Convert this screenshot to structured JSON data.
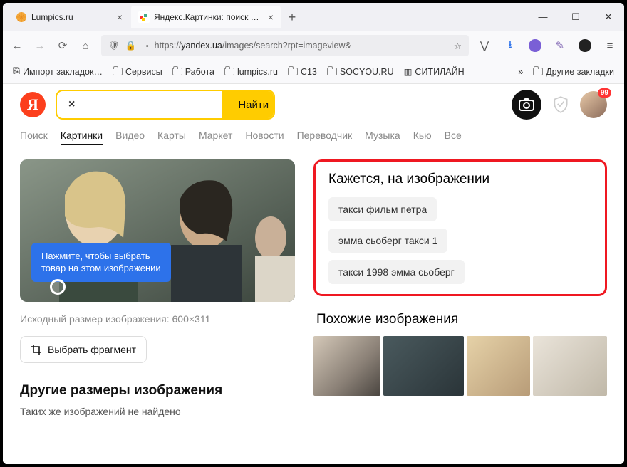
{
  "browser": {
    "tabs": [
      {
        "label": "Lumpics.ru"
      },
      {
        "label": "Яндекс.Картинки: поиск по из"
      }
    ],
    "url_prefix": "https://",
    "url_host": "yandex.ua",
    "url_path": "/images/search?rpt=imageview&"
  },
  "bookmarks": [
    "Импорт закладок…",
    "Сервисы",
    "Работа",
    "lumpics.ru",
    "C13",
    "SOCYOU.RU",
    "СИТИЛАЙН"
  ],
  "bookmarks_more": "Другие закладки",
  "search": {
    "button": "Найти",
    "badge": "99"
  },
  "nav": [
    "Поиск",
    "Картинки",
    "Видео",
    "Карты",
    "Маркет",
    "Новости",
    "Переводчик",
    "Музыка",
    "Кью",
    "Все"
  ],
  "nav_active": 1,
  "tip": {
    "l1": "Нажмите, чтобы выбрать",
    "l2": "товар на этом изображении"
  },
  "src_size": "Исходный размер изображения: 600×311",
  "frag": "Выбрать фрагмент",
  "other_sizes": {
    "title": "Другие размеры изображения",
    "sub": "Таких же изображений не найдено"
  },
  "guess": {
    "title": "Кажется, на изображении",
    "chips": [
      "такси фильм петра",
      "эмма сьоберг такси 1",
      "такси 1998 эмма сьоберг"
    ]
  },
  "similar": "Похожие изображения"
}
